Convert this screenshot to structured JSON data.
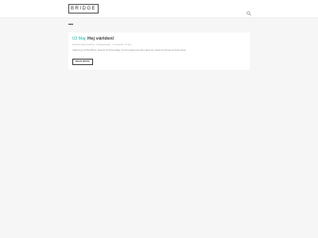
{
  "header": {
    "logo_text": "BRIDGE",
    "search_icon": "search-icon"
  },
  "post": {
    "date": "03 Maj",
    "title": "Hej världen!",
    "meta": {
      "author": "Postat av Qode Interactive",
      "category": "Okategoriserade",
      "comments": "1 Kommentar",
      "likes": "0 Likes"
    },
    "excerpt": "Välkommen till WordPress. Detta är ditt första inlägg. Du kan redigera det eller radera det. Sedan är det bara att börja skriva...",
    "read_more_label": "Read More"
  },
  "colors": {
    "accent": "#1abc9c",
    "background": "#f6f6f6",
    "card": "#ffffff"
  }
}
